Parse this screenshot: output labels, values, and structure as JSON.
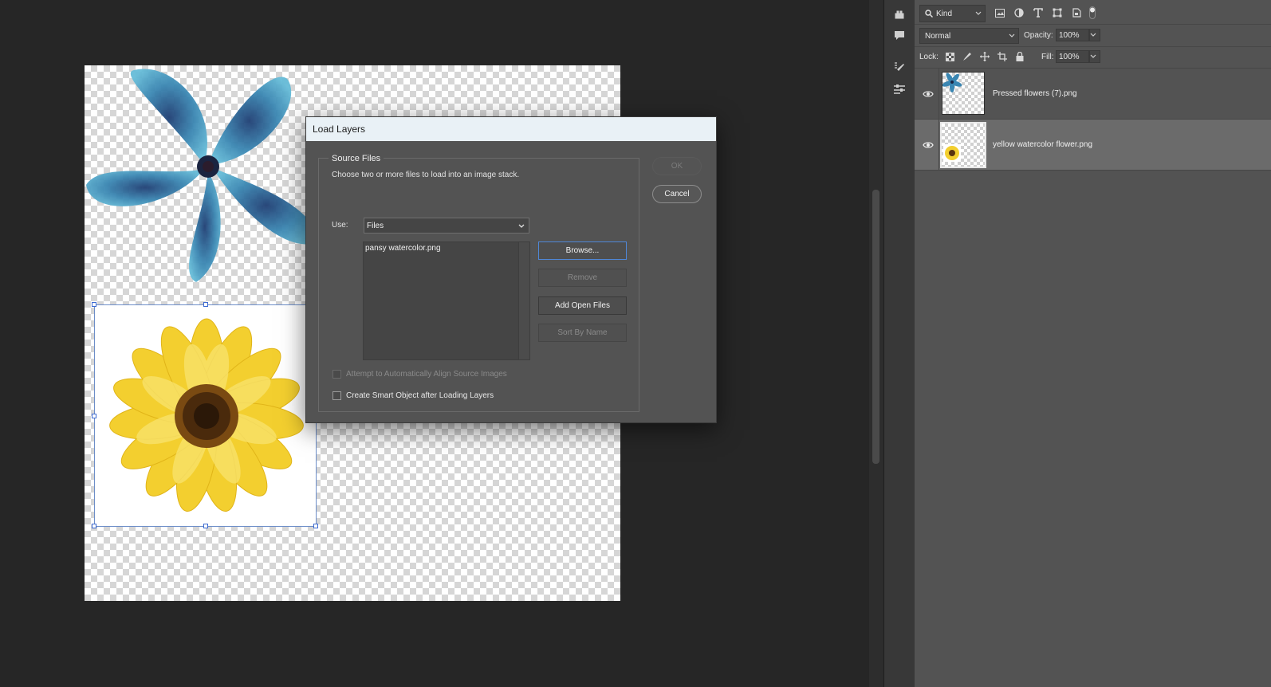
{
  "dialog": {
    "title": "Load Layers",
    "group_label": "Source Files",
    "instructions": "Choose two or more files to load into an image stack.",
    "use_label": "Use:",
    "use_value": "Files",
    "files": [
      "pansy watercolor.png"
    ],
    "buttons": {
      "ok": "OK",
      "cancel": "Cancel",
      "browse": "Browse...",
      "remove": "Remove",
      "add_open_files": "Add Open Files",
      "sort_by_name": "Sort By Name"
    },
    "checkboxes": {
      "auto_align": "Attempt to Automatically Align Source Images",
      "smart_object": "Create Smart Object after Loading Layers"
    }
  },
  "layers_panel": {
    "filter_label": "Kind",
    "blend_mode": "Normal",
    "opacity_label": "Opacity:",
    "opacity_value": "100%",
    "lock_label": "Lock:",
    "fill_label": "Fill:",
    "fill_value": "100%",
    "layers": [
      {
        "name": "Pressed flowers (7).png",
        "visible": true,
        "selected": false
      },
      {
        "name": "yellow watercolor flower.png",
        "visible": true,
        "selected": true
      }
    ]
  },
  "colors": {
    "accent": "#4f87d8",
    "dialog_bg": "#535353",
    "panel_bg": "#535353",
    "workspace_bg": "#262626"
  }
}
